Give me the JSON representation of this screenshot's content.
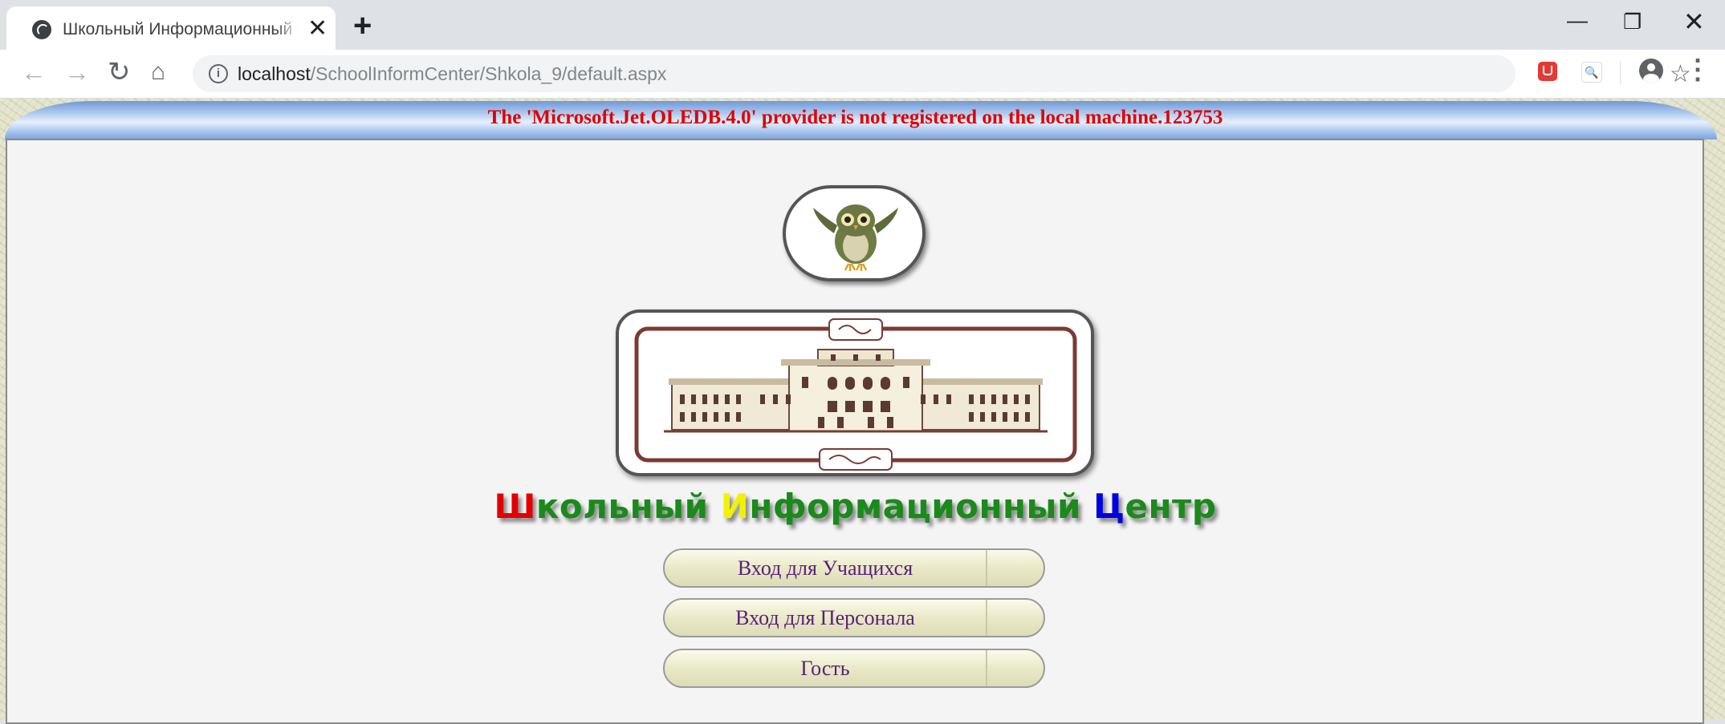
{
  "browser": {
    "tab_title": "Школьный Информационный Центр",
    "tab_close": "✕",
    "new_tab": "+",
    "window_controls": {
      "minimize": "—",
      "maximize": "❐",
      "close": "✕"
    },
    "nav": {
      "back": "←",
      "forward": "→",
      "reload": "↻",
      "home": "⌂"
    },
    "url_host": "localhost",
    "url_path": "/SchoolInformCenter/Shkola_9/default.aspx",
    "info_icon": "i",
    "star_icon": "☆",
    "ext_search_icon": "🔍",
    "menu_icon": "⋮"
  },
  "page": {
    "error_message": "The 'Microsoft.Jet.OLEDB.4.0' provider is not registered on the local machine.123753",
    "owl_alt": "owl",
    "school_alt": "school building",
    "title_parts": {
      "l1": "Ш",
      "w1": "кольный ",
      "l2": "И",
      "w2": "нформационный ",
      "l3": "Ц",
      "w3": "ентр"
    },
    "buttons": {
      "students": "Вход для Учащихся",
      "staff": "Вход для Персонала",
      "guest": "Гость"
    }
  }
}
